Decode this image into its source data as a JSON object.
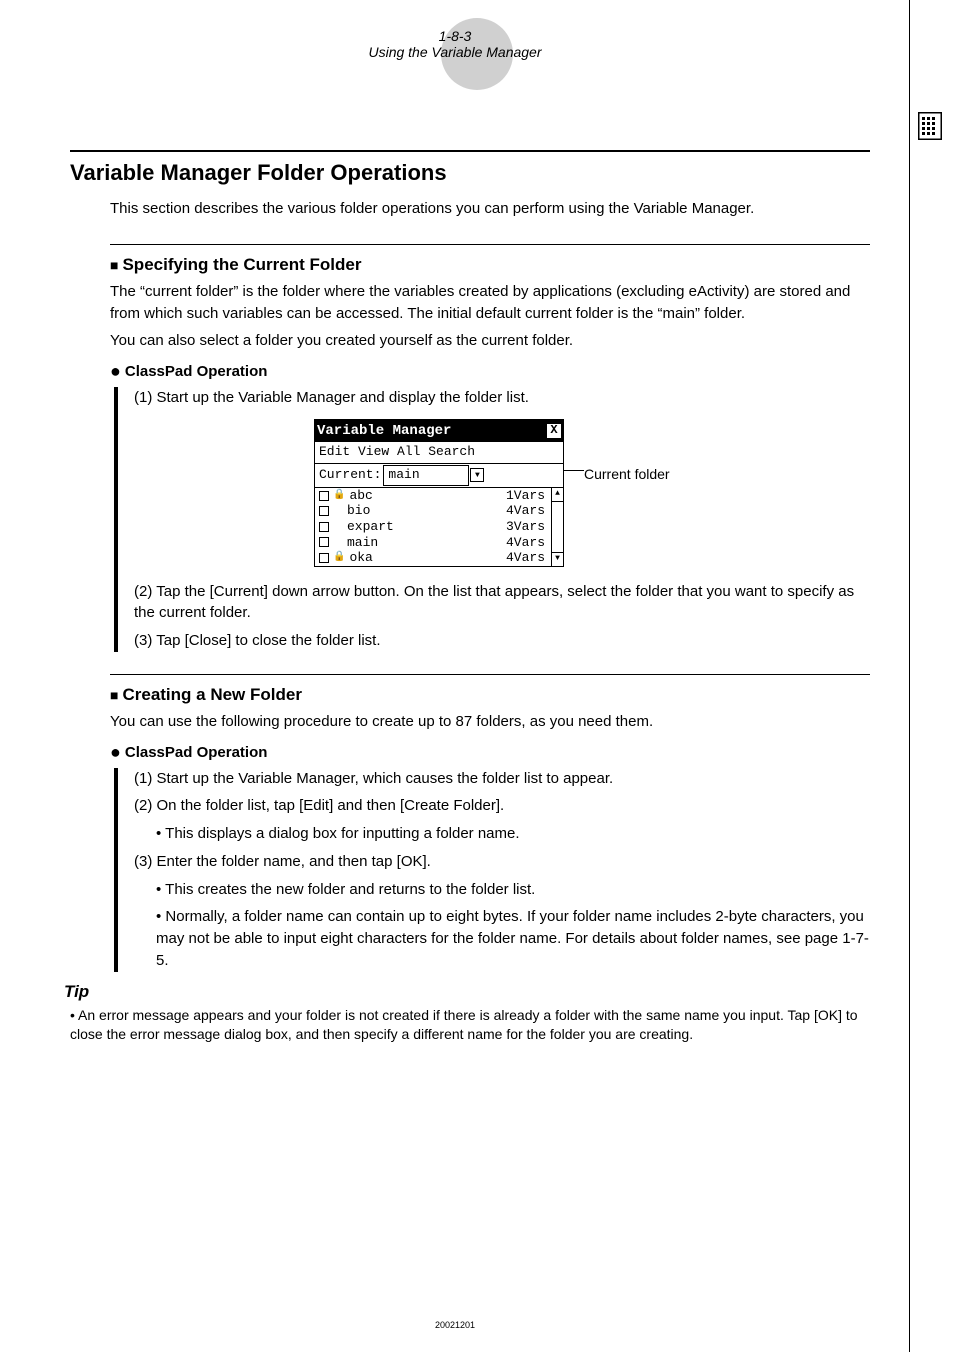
{
  "header": {
    "page_ref": "1-8-3",
    "page_title": "Using the Variable Manager"
  },
  "title": "Variable Manager Folder Operations",
  "intro": "This section describes the various folder operations you can perform using the Variable Manager.",
  "sec1": {
    "heading": "Specifying the Current Folder",
    "p1": "The “current folder” is the folder where the variables created by applications (excluding eActivity) are stored and from which such variables can be accessed. The initial default current folder is the “main” folder.",
    "p2": "You can also select a folder you created yourself as the current folder.",
    "op_label": "ClassPad Operation",
    "step1": "(1) Start up the Variable Manager and display the folder list.",
    "step2": "(2) Tap the [Current] down arrow button. On the list that appears, select the folder that you want to specify as the current folder.",
    "step3": "(3) Tap [Close] to close the folder list."
  },
  "calc": {
    "title": "Variable Manager",
    "menu": "Edit View All Search",
    "current_label": "Current:",
    "current_value": "main",
    "callout": "Current folder",
    "rows": [
      {
        "locked": true,
        "name": "abc",
        "vars": "1Vars"
      },
      {
        "locked": false,
        "name": "bio",
        "vars": "4Vars"
      },
      {
        "locked": false,
        "name": "expart",
        "vars": "3Vars"
      },
      {
        "locked": false,
        "name": "main",
        "vars": "4Vars"
      },
      {
        "locked": true,
        "name": "oka",
        "vars": "4Vars"
      }
    ]
  },
  "sec2": {
    "heading": "Creating a New Folder",
    "p1": "You can use the following procedure to create up to 87 folders, as you need them.",
    "op_label": "ClassPad Operation",
    "step1": "(1) Start up the Variable Manager, which causes the folder list to appear.",
    "step2": "(2) On the folder list, tap [Edit] and then [Create Folder].",
    "step2b": "This displays a dialog box for inputting a folder name.",
    "step3": "(3) Enter the folder name, and then tap [OK].",
    "step3b": "This creates the new folder and returns to the folder list.",
    "step3c": "Normally, a folder name can contain up to eight bytes. If your folder name includes 2-byte characters, you may not be able to input eight characters for the folder name. For details about folder names, see page 1-7-5."
  },
  "tip": {
    "heading": "Tip",
    "body": "An error message appears and your folder is not created if there is already a folder with the same name you input. Tap [OK] to close the error message dialog box, and then specify a different name for the folder you are creating."
  },
  "footer_id": "20021201"
}
